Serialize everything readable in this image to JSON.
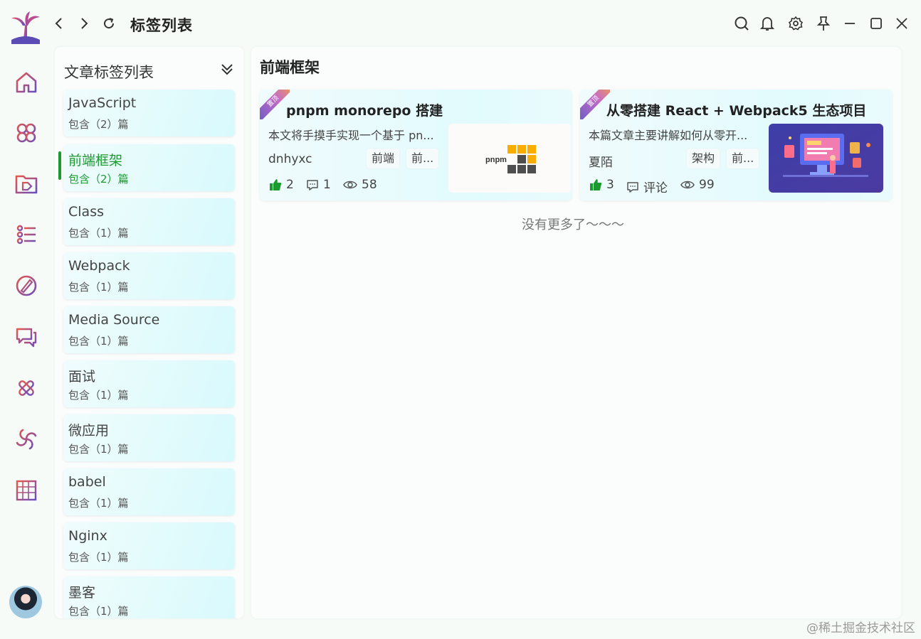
{
  "window": {
    "title": "标签列表"
  },
  "tag_panel": {
    "title": "文章标签列表",
    "tags": [
      {
        "name": "JavaScript",
        "count": "包含（2）篇"
      },
      {
        "name": "前端框架",
        "count": "包含（2）篇",
        "active": true
      },
      {
        "name": "Class",
        "count": "包含（1）篇"
      },
      {
        "name": "Webpack",
        "count": "包含（1）篇"
      },
      {
        "name": "Media Source",
        "count": "包含（1）篇"
      },
      {
        "name": "面试",
        "count": "包含（1）篇"
      },
      {
        "name": "微应用",
        "count": "包含（1）篇"
      },
      {
        "name": "babel",
        "count": "包含（1）篇"
      },
      {
        "name": "Nginx",
        "count": "包含（1）篇"
      },
      {
        "name": "墨客",
        "count": "包含（1）篇"
      }
    ]
  },
  "content": {
    "title": "前端框架",
    "articles": [
      {
        "ribbon": "置顶",
        "title": "pnpm monorepo 搭建",
        "summary": "本文将手摸手实现一个基于 pn...",
        "author": "dnhyxc",
        "tags": [
          "前端",
          "前..."
        ],
        "likes": "2",
        "comments": "1",
        "views": "58",
        "thumb_text": "pnpm"
      },
      {
        "ribbon": "置顶",
        "title": "从零搭建 React + Webpack5 生态项目",
        "summary": "本篇文章主要讲解如何从零开...",
        "author": "夏陌",
        "tags": [
          "架构",
          "前..."
        ],
        "likes": "3",
        "comments": "评论",
        "views": "99"
      }
    ],
    "no_more": "没有更多了～～～"
  },
  "watermark": "@稀土掘金技术社区",
  "colors": {
    "accent_green": "#1b9a30",
    "rail_gradient_start": "#e8564a",
    "rail_gradient_end": "#6a4fc2"
  },
  "rail_icons": [
    "home-icon",
    "apps-icon",
    "tag-folder-icon",
    "list-icon",
    "pen-icon",
    "chat-icon",
    "tools-icon",
    "spiral-icon",
    "grid-icon"
  ]
}
